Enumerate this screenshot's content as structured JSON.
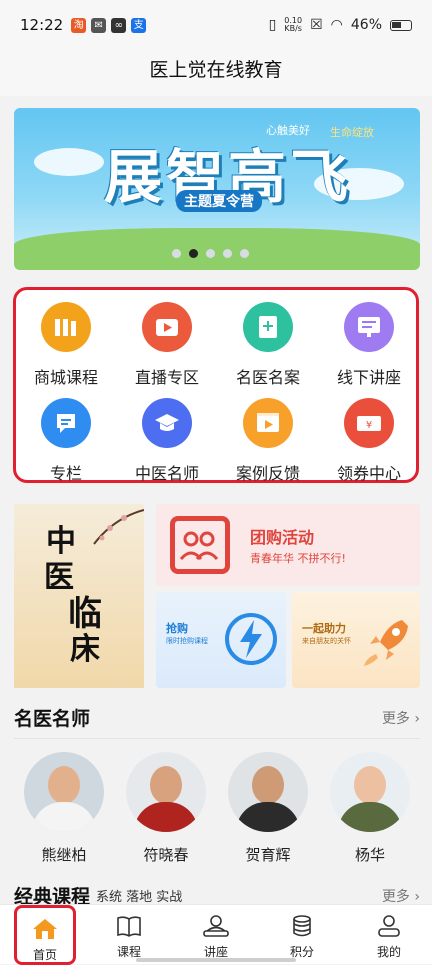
{
  "status": {
    "time": "12:22",
    "net_speed_top": "0.10",
    "net_speed_bottom": "KB/s",
    "battery": "46%"
  },
  "app": {
    "title": "医上觉在线教育"
  },
  "banner": {
    "title": "展智高飞",
    "subtitle": "主题夏令营",
    "tag1": "心触美好",
    "tag2": "生命绽放",
    "dot_count": 5,
    "active_dot": 2
  },
  "grid": {
    "items": [
      {
        "label": "商城课程",
        "icon": "books-icon",
        "color": "#f3a31b"
      },
      {
        "label": "直播专区",
        "icon": "live-play-icon",
        "color": "#eb5a3c"
      },
      {
        "label": "名医名案",
        "icon": "document-plus-icon",
        "color": "#2ec1a0"
      },
      {
        "label": "线下讲座",
        "icon": "lecture-list-icon",
        "color": "#9f7bf2"
      },
      {
        "label": "专栏",
        "icon": "column-chat-icon",
        "color": "#2f8df2"
      },
      {
        "label": "中医名师",
        "icon": "graduation-cap-icon",
        "color": "#4d6ef0"
      },
      {
        "label": "案例反馈",
        "icon": "video-clip-icon",
        "color": "#f7a12a"
      },
      {
        "label": "领券中心",
        "icon": "coupon-icon",
        "color": "#ea4f3c"
      }
    ]
  },
  "promo": {
    "poster_chars": [
      "中",
      "医",
      "临",
      "床"
    ],
    "group_title": "团购活动",
    "group_sub": "青春年华 不拼不行!",
    "flash_title": "抢购",
    "flash_sub": "限时抢购课程",
    "help_title": "一起助力",
    "help_sub": "来自朋友的关怀"
  },
  "famous": {
    "title": "名医名师",
    "more": "更多",
    "teachers": [
      {
        "name": "熊继柏"
      },
      {
        "name": "符晓春"
      },
      {
        "name": "贺育辉"
      },
      {
        "name": "杨华"
      }
    ]
  },
  "classic": {
    "title": "经典课程",
    "tags": "系统 落地 实战",
    "more": "更多"
  },
  "tabs": [
    {
      "label": "首页"
    },
    {
      "label": "课程"
    },
    {
      "label": "讲座"
    },
    {
      "label": "积分"
    },
    {
      "label": "我的"
    }
  ]
}
